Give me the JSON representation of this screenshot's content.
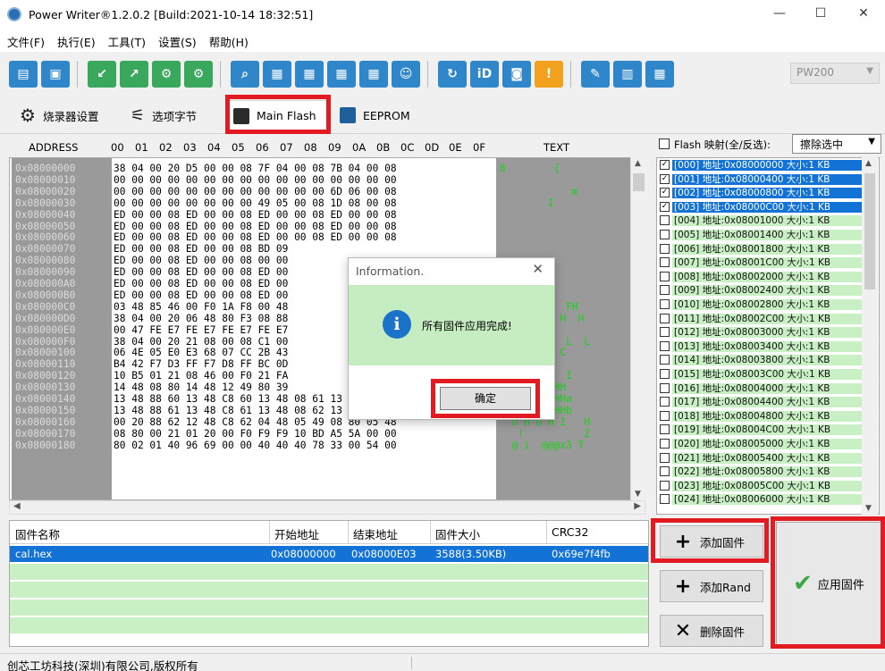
{
  "window": {
    "title": "Power Writer®1.2.0.2 [Build:2021-10-14 18:32:51]",
    "minimize": "—",
    "maximize": "☐",
    "close": "✕"
  },
  "menu": [
    "文件(F)",
    "执行(E)",
    "工具(T)",
    "设置(S)",
    "帮助(H)"
  ],
  "toolbar": {
    "device_select": "PW200",
    "icons": [
      "open-icon",
      "save-icon",
      "download-icon",
      "upload-icon",
      "chip-icon-1",
      "chip-icon-2",
      "search-icon",
      "chip-read-icon",
      "chip-write-icon",
      "chip-verify-icon",
      "chip-erase-icon",
      "robot-icon",
      "refresh-icon",
      "id-icon",
      "chip-info-icon",
      "warning-icon",
      "clean-icon",
      "template-icon",
      "layout-icon"
    ]
  },
  "tabs": [
    {
      "label": "烧录器设置",
      "icon": "gear-icon"
    },
    {
      "label": "选项字节",
      "icon": "option-byte-icon"
    },
    {
      "label": "Main Flash",
      "icon": "flash-icon"
    },
    {
      "label": "EEPROM",
      "icon": "eeprom-icon"
    }
  ],
  "hex_view": {
    "headers": {
      "address": "ADDRESS",
      "bytes": [
        "00",
        "01",
        "02",
        "03",
        "04",
        "05",
        "06",
        "07",
        "08",
        "09",
        "0A",
        "0B",
        "0C",
        "0D",
        "0E",
        "0F"
      ],
      "text": "TEXT"
    },
    "rows": [
      {
        "addr": "0x08000000",
        "bytes": "38 04 00 20 D5 00 00 08 7F 04 00 08 7B 04 00 08",
        "text": "8        {"
      },
      {
        "addr": "0x08000010",
        "bytes": "00 00 00 00 00 00 00 00 00 00 00 00 00 00 00 00",
        "text": ""
      },
      {
        "addr": "0x08000020",
        "bytes": "00 00 00 00 00 00 00 00 00 00 00 00 6D 06 00 08",
        "text": "            m"
      },
      {
        "addr": "0x08000030",
        "bytes": "00 00 00 00 00 00 00 00 49 05 00 08 1D 08 00 08",
        "text": "        I"
      },
      {
        "addr": "0x08000040",
        "bytes": "ED 00 00 08 ED 00 00 08 ED 00 00 08 ED 00 00 08",
        "text": ""
      },
      {
        "addr": "0x08000050",
        "bytes": "ED 00 00 08 ED 00 00 08 ED 00 00 08 ED 00 00 08",
        "text": ""
      },
      {
        "addr": "0x08000060",
        "bytes": "ED 00 00 08 ED 00 00 08 ED 00 00 08 ED 00 00 08",
        "text": ""
      },
      {
        "addr": "0x08000070",
        "bytes": "ED 00 00 08 ED 00 00 08 BD 09",
        "text": ""
      },
      {
        "addr": "0x08000080",
        "bytes": "ED 00 00 08 ED 00 00 08 00 00",
        "text": ""
      },
      {
        "addr": "0x08000090",
        "bytes": "ED 00 00 08 ED 00 00 08 ED 00",
        "text": ""
      },
      {
        "addr": "0x080000A0",
        "bytes": "ED 00 00 08 ED 00 00 08 ED 00",
        "text": ""
      },
      {
        "addr": "0x080000B0",
        "bytes": "ED 00 00 08 ED 00 00 08 ED 00",
        "text": ""
      },
      {
        "addr": "0x080000C0",
        "bytes": "03 48 85 46 00 F0 1A F8 00 48",
        "text": "        H  FH"
      },
      {
        "addr": "0x080000D0",
        "bytes": "38 04 00 20 06 48 80 F3 08 88",
        "text": "          H  H"
      },
      {
        "addr": "0x080000E0",
        "bytes": "00 47 FE E7 FE E7 FE E7 FE E7",
        "text": ""
      },
      {
        "addr": "0x080000F0",
        "bytes": "38 04 00 20 21 08 00 08 C1 00",
        "text": "           L  L"
      },
      {
        "addr": "0x08000100",
        "bytes": "06 4E 05 E0 E3 68 07 CC 2B 43",
        "text": "      +C  C"
      },
      {
        "addr": "0x08000110",
        "bytes": "B4 42 F7 D3 FF F7 D8 FF BC 0D",
        "text": ""
      },
      {
        "addr": "0x08000120",
        "bytes": "10 B5 01 21 08 46 00 F0 21 FA",
        "text": "        H  I"
      },
      {
        "addr": "0x08000130",
        "bytes": "14 48 08 80 14 48 12 49 80 39",
        "text": "   H  H  HH"
      },
      {
        "addr": "0x08000140",
        "bytes": "13 48 88 60 13 48 C8 60 13 48 08 61 13 48 48 61",
        "text": "H `H `H aHHa"
      },
      {
        "addr": "0x08000150",
        "bytes": "13 48 88 61 13 48 C8 61 13 48 08 62 13 48 48 62",
        "text": "H aH aH bHHb"
      },
      {
        "addr": "0x08000160",
        "bytes": "00 20 88 62 12 48 C8 62 04 48 05 49 08 80 05 48",
        "text": "  b H b H I   H"
      },
      {
        "addr": "0x08000170",
        "bytes": "08 80 00 21 01 20 00 F0 F9 F9 10 BD A5 5A 00 00",
        "text": "   !          Z"
      },
      {
        "addr": "0x08000180",
        "bytes": "80 02 01 40 96 69 00 00 40 40 40 78 33 00 54 00",
        "text": "  @ i  @@@x3 T"
      }
    ]
  },
  "flash_map": {
    "header_label": "Flash 映射(全/反选):",
    "action_select": "擦除选中",
    "items": [
      {
        "label": "[000] 地址:0x08000000 大小:1 KB",
        "checked": true
      },
      {
        "label": "[001] 地址:0x08000400 大小:1 KB",
        "checked": true
      },
      {
        "label": "[002] 地址:0x08000800 大小:1 KB",
        "checked": true
      },
      {
        "label": "[003] 地址:0x08000C00 大小:1 KB",
        "checked": true
      },
      {
        "label": "[004] 地址:0x08001000 大小:1 KB",
        "checked": false
      },
      {
        "label": "[005] 地址:0x08001400 大小:1 KB",
        "checked": false
      },
      {
        "label": "[006] 地址:0x08001800 大小:1 KB",
        "checked": false
      },
      {
        "label": "[007] 地址:0x08001C00 大小:1 KB",
        "checked": false
      },
      {
        "label": "[008] 地址:0x08002000 大小:1 KB",
        "checked": false
      },
      {
        "label": "[009] 地址:0x08002400 大小:1 KB",
        "checked": false
      },
      {
        "label": "[010] 地址:0x08002800 大小:1 KB",
        "checked": false
      },
      {
        "label": "[011] 地址:0x08002C00 大小:1 KB",
        "checked": false
      },
      {
        "label": "[012] 地址:0x08003000 大小:1 KB",
        "checked": false
      },
      {
        "label": "[013] 地址:0x08003400 大小:1 KB",
        "checked": false
      },
      {
        "label": "[014] 地址:0x08003800 大小:1 KB",
        "checked": false
      },
      {
        "label": "[015] 地址:0x08003C00 大小:1 KB",
        "checked": false
      },
      {
        "label": "[016] 地址:0x08004000 大小:1 KB",
        "checked": false
      },
      {
        "label": "[017] 地址:0x08004400 大小:1 KB",
        "checked": false
      },
      {
        "label": "[018] 地址:0x08004800 大小:1 KB",
        "checked": false
      },
      {
        "label": "[019] 地址:0x08004C00 大小:1 KB",
        "checked": false
      },
      {
        "label": "[020] 地址:0x08005000 大小:1 KB",
        "checked": false
      },
      {
        "label": "[021] 地址:0x08005400 大小:1 KB",
        "checked": false
      },
      {
        "label": "[022] 地址:0x08005800 大小:1 KB",
        "checked": false
      },
      {
        "label": "[023] 地址:0x08005C00 大小:1 KB",
        "checked": false
      },
      {
        "label": "[024] 地址:0x08006000 大小:1 KB",
        "checked": false
      }
    ]
  },
  "firmware_table": {
    "columns": [
      "固件名称",
      "开始地址",
      "结束地址",
      "固件大小",
      "CRC32"
    ],
    "rows": [
      {
        "name": "cal.hex",
        "start": "0x08000000",
        "end": "0x08000E03",
        "size": "3588(3.50KB)",
        "crc": "0x69e7f4fb"
      }
    ]
  },
  "buttons": {
    "add_firmware": "添加固件",
    "add_rand": "添加Rand",
    "delete_firmware": "删除固件",
    "apply_firmware": "应用固件"
  },
  "dialog": {
    "title": "Information.",
    "message": "所有固件应用完成!",
    "ok": "确定"
  },
  "status": {
    "text": "创芯工坊科技(深圳)有限公司,版权所有"
  },
  "colors": {
    "accent_blue": "#2f86c9",
    "accent_green": "#3aa85c",
    "highlight_red": "#e21b23",
    "selection_blue": "#1272d6",
    "list_green": "#c9efc4",
    "hex_text_green": "#19d419"
  }
}
